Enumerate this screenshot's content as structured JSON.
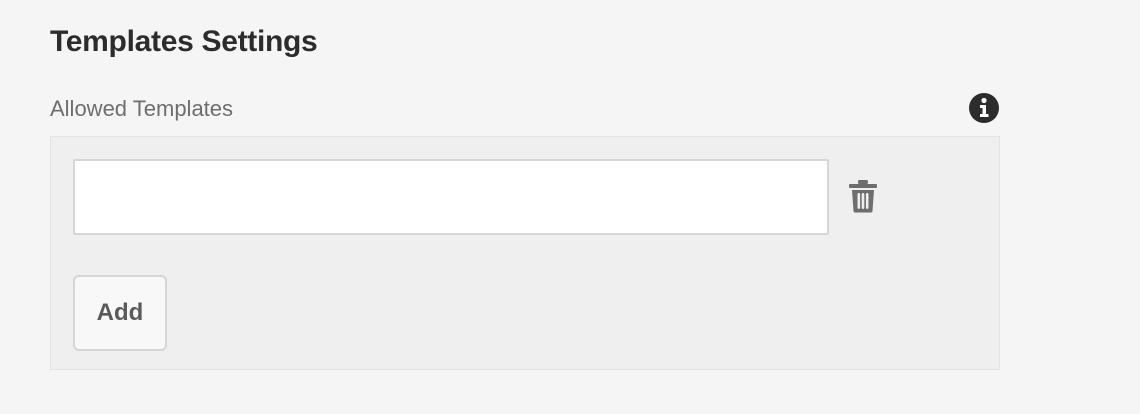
{
  "section": {
    "title": "Templates Settings"
  },
  "field": {
    "label": "Allowed Templates",
    "info_icon": "info-icon",
    "items": [
      {
        "value": "",
        "placeholder": ""
      }
    ],
    "delete_icon": "trash-icon",
    "add_label": "Add"
  },
  "colors": {
    "background": "#f5f5f5",
    "panel": "#efefef",
    "text_dark": "#2c2c2c",
    "text_muted": "#6e6e6e",
    "border": "#d6d6d6"
  }
}
